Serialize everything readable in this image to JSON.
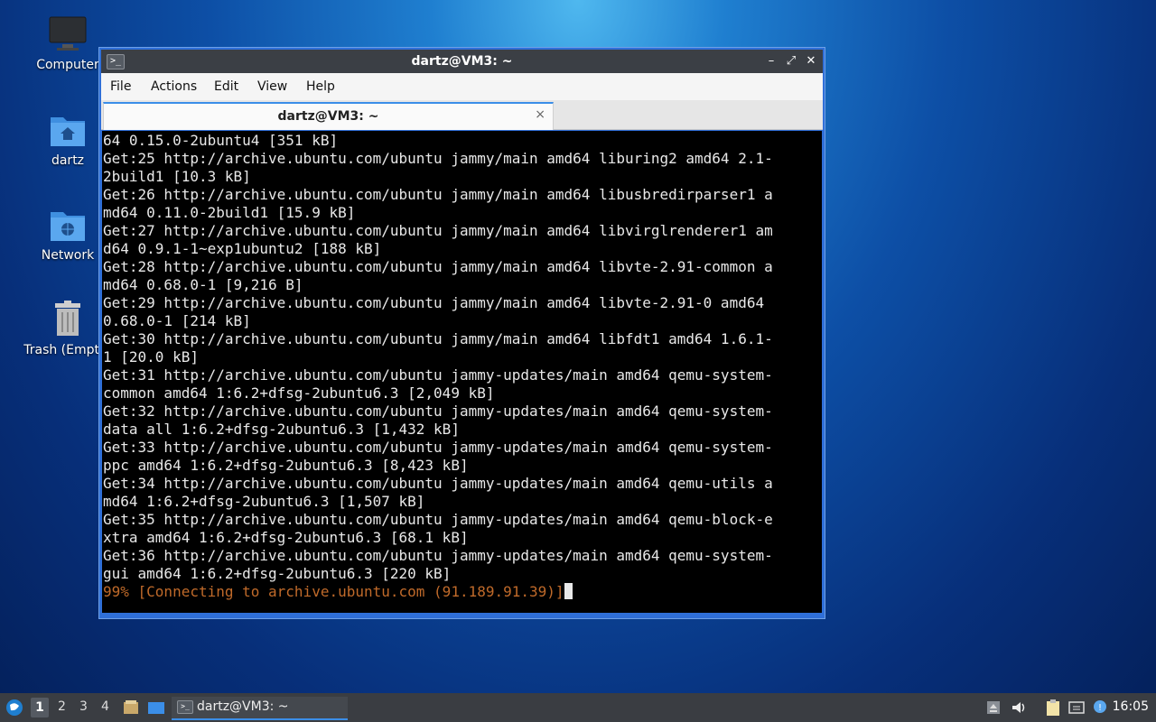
{
  "desktop": {
    "icons": [
      {
        "label": "Computer",
        "icon": "monitor-icon"
      },
      {
        "label": "dartz",
        "icon": "home-folder-icon"
      },
      {
        "label": "Network",
        "icon": "network-folder-icon"
      },
      {
        "label": "Trash (Empty)",
        "icon": "trash-icon"
      }
    ]
  },
  "window": {
    "title": "dartz@VM3: ~",
    "app_icon_glyph": ">_",
    "controls": {
      "minimize": "–",
      "maximize": "⤢",
      "close": "✕"
    },
    "menu": [
      "File",
      "Actions",
      "Edit",
      "View",
      "Help"
    ],
    "tab": {
      "label": "dartz@VM3: ~",
      "close": "×"
    }
  },
  "terminal": {
    "lines": [
      "64 0.15.0-2ubuntu4 [351 kB]",
      "Get:25 http://archive.ubuntu.com/ubuntu jammy/main amd64 liburing2 amd64 2.1-",
      "2build1 [10.3 kB]",
      "Get:26 http://archive.ubuntu.com/ubuntu jammy/main amd64 libusbredirparser1 a",
      "md64 0.11.0-2build1 [15.9 kB]",
      "Get:27 http://archive.ubuntu.com/ubuntu jammy/main amd64 libvirglrenderer1 am",
      "d64 0.9.1-1~exp1ubuntu2 [188 kB]",
      "Get:28 http://archive.ubuntu.com/ubuntu jammy/main amd64 libvte-2.91-common a",
      "md64 0.68.0-1 [9,216 B]",
      "Get:29 http://archive.ubuntu.com/ubuntu jammy/main amd64 libvte-2.91-0 amd64",
      "0.68.0-1 [214 kB]",
      "Get:30 http://archive.ubuntu.com/ubuntu jammy/main amd64 libfdt1 amd64 1.6.1-",
      "1 [20.0 kB]",
      "Get:31 http://archive.ubuntu.com/ubuntu jammy-updates/main amd64 qemu-system-",
      "common amd64 1:6.2+dfsg-2ubuntu6.3 [2,049 kB]",
      "Get:32 http://archive.ubuntu.com/ubuntu jammy-updates/main amd64 qemu-system-",
      "data all 1:6.2+dfsg-2ubuntu6.3 [1,432 kB]",
      "Get:33 http://archive.ubuntu.com/ubuntu jammy-updates/main amd64 qemu-system-",
      "ppc amd64 1:6.2+dfsg-2ubuntu6.3 [8,423 kB]",
      "Get:34 http://archive.ubuntu.com/ubuntu jammy-updates/main amd64 qemu-utils a",
      "md64 1:6.2+dfsg-2ubuntu6.3 [1,507 kB]",
      "Get:35 http://archive.ubuntu.com/ubuntu jammy-updates/main amd64 qemu-block-e",
      "xtra amd64 1:6.2+dfsg-2ubuntu6.3 [68.1 kB]",
      "Get:36 http://archive.ubuntu.com/ubuntu jammy-updates/main amd64 qemu-system-",
      "gui amd64 1:6.2+dfsg-2ubuntu6.3 [220 kB]"
    ],
    "progress_line": "99% [Connecting to archive.ubuntu.com (91.189.91.39)]"
  },
  "panel": {
    "workspaces": [
      "1",
      "2",
      "3",
      "4"
    ],
    "active_workspace": "1",
    "task_label": "dartz@VM3: ~",
    "clock": "16:05"
  },
  "colors": {
    "progress_text": "#c06a2a",
    "accent": "#3b8ee8",
    "window_frame": "#2f6fd8"
  }
}
